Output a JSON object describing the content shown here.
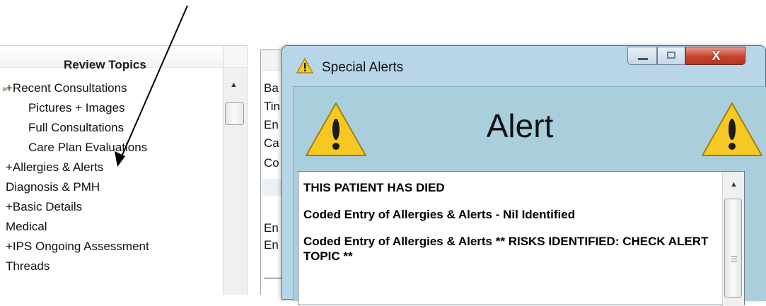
{
  "review_panel": {
    "header": "Review Topics",
    "items": [
      {
        "label": "+Recent Consultations"
      },
      {
        "label": "Pictures + Images"
      },
      {
        "label": "Full Consultations"
      },
      {
        "label": "Care Plan Evaluations"
      },
      {
        "label": "+Allergies & Alerts"
      },
      {
        "label": "Diagnosis & PMH"
      },
      {
        "label": "+Basic Details"
      },
      {
        "label": "Medical"
      },
      {
        "label": "+IPS Ongoing Assessment"
      },
      {
        "label": "Threads"
      }
    ]
  },
  "detail_panel": {
    "fragments": [
      "Ba",
      "Tin",
      "En",
      "Ca",
      "Co",
      "En",
      "En"
    ]
  },
  "dialog": {
    "title": "Special Alerts",
    "close_label": "X",
    "heading": "Alert",
    "messages": [
      "THIS PATIENT HAS DIED",
      "Coded Entry of Allergies & Alerts - Nil Identified",
      "Coded Entry of Allergies & Alerts ** RISKS IDENTIFIED: CHECK ALERT TOPIC **"
    ]
  },
  "colors": {
    "dialog_frame": "#b9d5e8",
    "dialog_client": "#a9cfdd",
    "close_button": "#c9412c",
    "warning_yellow": "#f6c823"
  }
}
